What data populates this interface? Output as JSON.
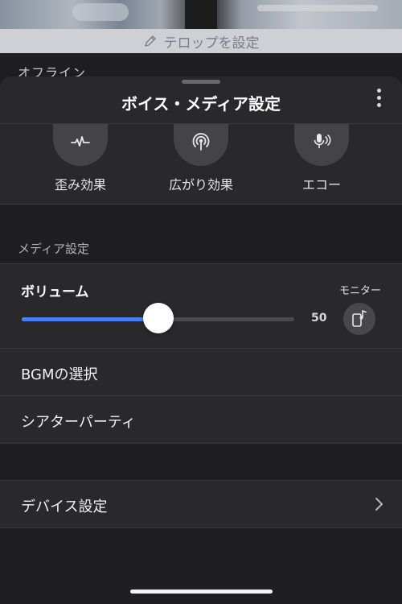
{
  "background": {
    "caption_action": "テロップを設定",
    "status_text": "オフライン"
  },
  "sheet": {
    "title": "ボイス・メディア設定",
    "menu_icon": "more-vertical-icon"
  },
  "effects": [
    {
      "label": "歪み効果",
      "icon": "waveform-icon"
    },
    {
      "label": "広がり効果",
      "icon": "broadcast-icon"
    },
    {
      "label": "エコー",
      "icon": "microphone-echo-icon"
    }
  ],
  "media_settings": {
    "section_label": "メディア設定",
    "volume": {
      "label": "ボリューム",
      "value": 50,
      "value_text": "50",
      "monitor_label": "モニター",
      "monitor_icon": "phone-music-icon"
    },
    "items": [
      {
        "label": "BGMの選択"
      },
      {
        "label": "シアターパーティ"
      }
    ]
  },
  "device_settings": {
    "label": "デバイス設定",
    "icon": "chevron-right-icon"
  },
  "colors": {
    "accent": "#4a7ef0",
    "sheet_bg": "#29292c",
    "page_bg": "#1f1f21"
  }
}
